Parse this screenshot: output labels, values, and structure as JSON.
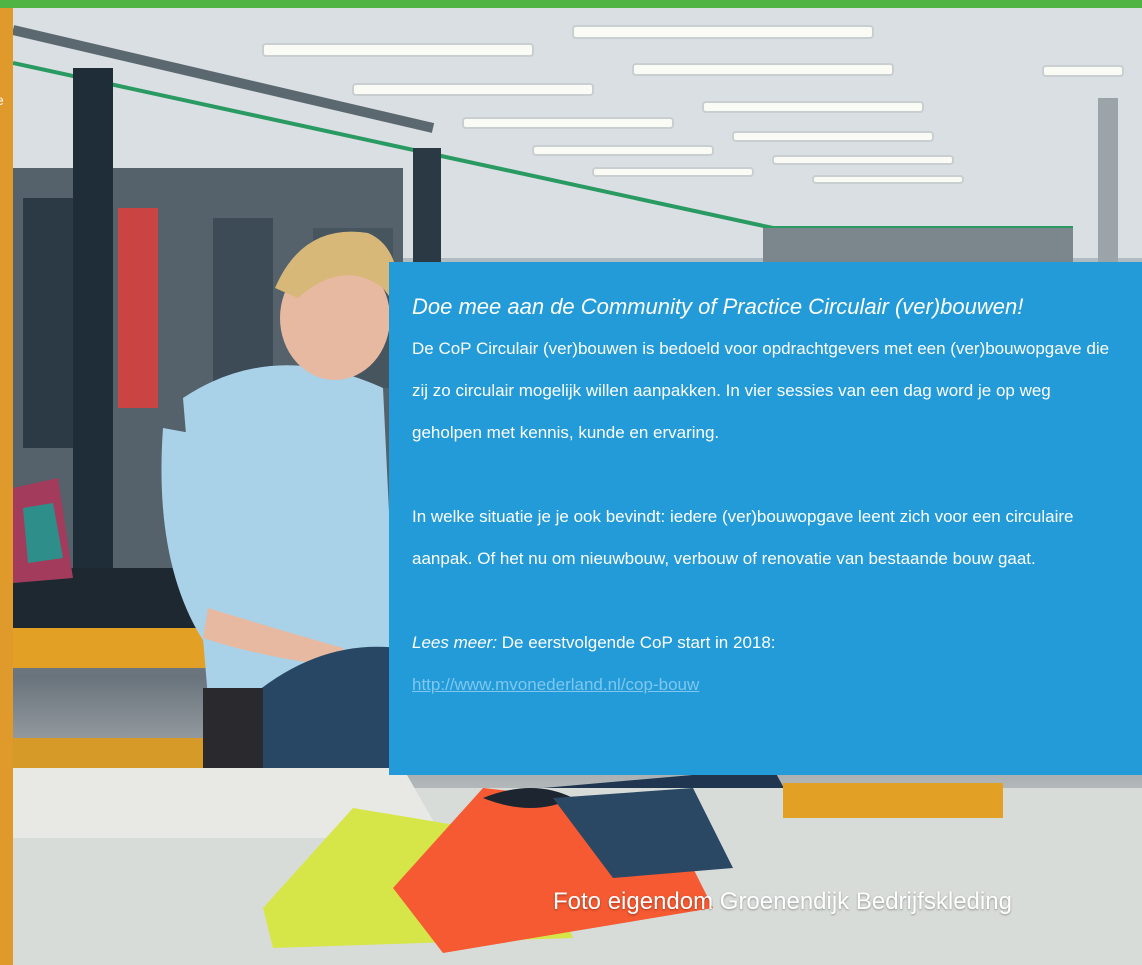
{
  "side_strip": {
    "edge_text": "e",
    "color": "#e09a2c"
  },
  "top_bar": {
    "color": "#4fb443"
  },
  "panel": {
    "title": "Doe mee aan de Community of Practice Circulair (ver)bouwen!",
    "paragraph1": "De CoP Circulair (ver)bouwen is bedoeld voor opdrachtgevers met een (ver)bouwopgave die zij zo circulair mogelijk willen aanpakken. In vier sessies van een dag word je op weg geholpen met kennis, kunde en ervaring.",
    "paragraph2": "In welke situatie je je ook bevindt: iedere (ver)bouwopgave leent zich voor een circulaire aanpak. Of het nu om nieuwbouw, verbouw of renovatie van bestaande bouw gaat.",
    "read_more_label": "Lees meer:",
    "read_more_text": "De eerstvolgende CoP start in 2018:",
    "link_text": "http://www.mvonederland.nl/cop-bouw",
    "background": "#229bd8"
  },
  "photo": {
    "caption": "Foto eigendom Groenendijk Bedrijfskleding",
    "subject": "factory-worker-folding-clothes"
  }
}
